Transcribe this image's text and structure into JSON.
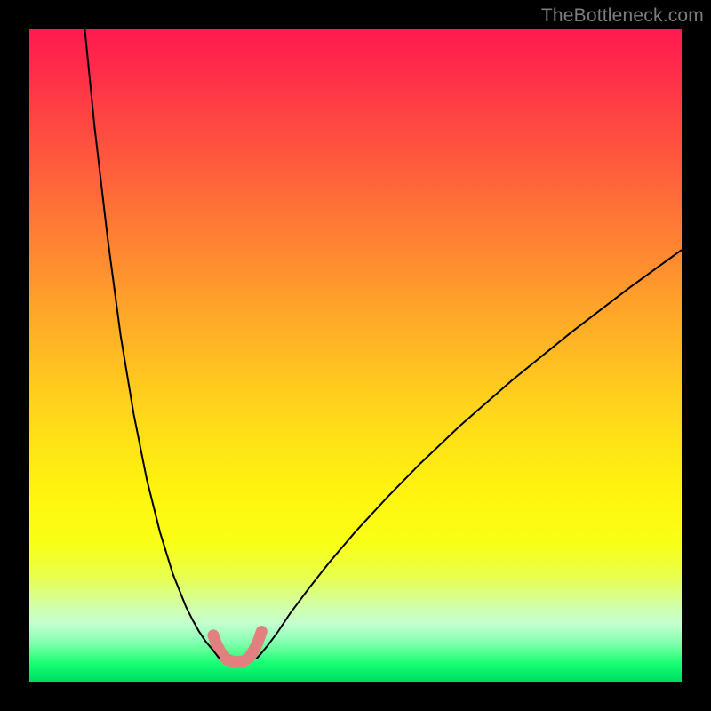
{
  "watermark": "TheBottleneck.com",
  "chart_data": {
    "type": "line",
    "title": "",
    "xlabel": "",
    "ylabel": "",
    "xlim": [
      0,
      100
    ],
    "ylim": [
      0,
      100
    ],
    "grid": false,
    "note": "Bottleneck V-curve. Axes unlabeled; values are positions in percent of plot area (x left→right, y top→bottom).",
    "series": [
      {
        "name": "left-branch",
        "stroke": "#000000",
        "stroke_width": 2,
        "x": [
          8.5,
          10,
          12,
          14,
          16,
          18,
          20,
          22,
          24,
          25,
          26,
          27,
          28,
          28.7,
          29.2
        ],
        "y": [
          0,
          15,
          32,
          47,
          59,
          69,
          77,
          83.5,
          88.5,
          90.5,
          92.3,
          93.8,
          95.0,
          95.9,
          96.5
        ]
      },
      {
        "name": "right-branch",
        "stroke": "#000000",
        "stroke_width": 2,
        "x": [
          34.8,
          35.5,
          36.5,
          38,
          40,
          43,
          46,
          50,
          55,
          60,
          66,
          74,
          83,
          92,
          100
        ],
        "y": [
          96.5,
          95.7,
          94.5,
          92.5,
          89.5,
          85.5,
          81.7,
          77,
          71.6,
          66.5,
          60.8,
          53.8,
          46.5,
          39.6,
          33.8
        ]
      },
      {
        "name": "trough-marker",
        "stroke": "#e28080",
        "stroke_width": 13,
        "linecap": "round",
        "x": [
          28.2,
          28.7,
          29.4,
          30.3,
          31.5,
          32.7,
          33.6,
          34.3,
          35.0,
          35.6
        ],
        "y": [
          92.9,
          94.3,
          95.6,
          96.6,
          97.0,
          96.9,
          96.4,
          95.4,
          94.0,
          92.3
        ]
      }
    ]
  }
}
